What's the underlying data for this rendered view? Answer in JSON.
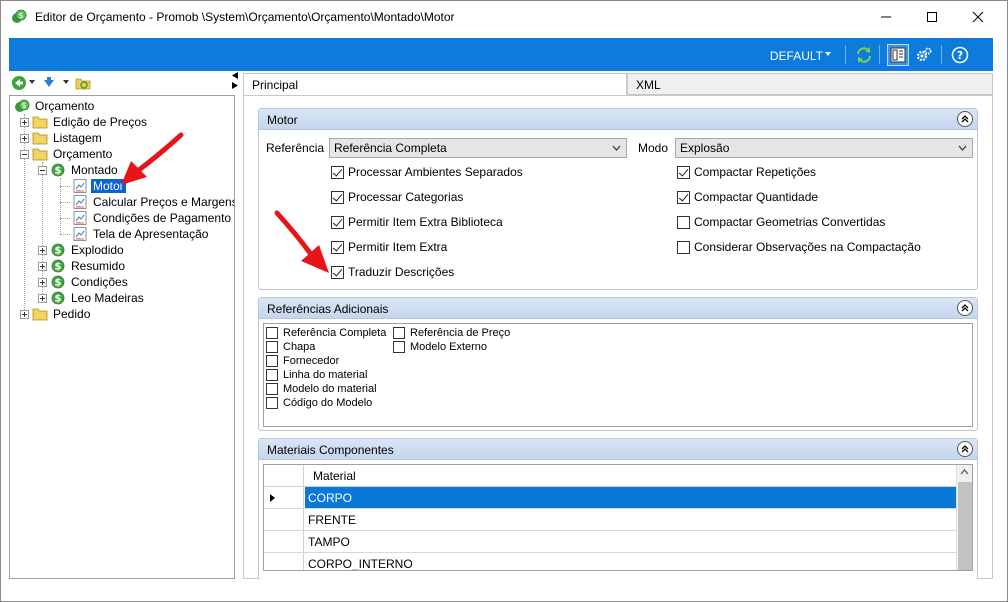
{
  "window": {
    "title": "Editor de Orçamento - Promob \\System\\Orçamento\\Orçamento\\Montado\\Motor"
  },
  "toolbar": {
    "profile_label": "DEFAULT",
    "icons": [
      "refresh-icon",
      "layout-icon",
      "settings-gears-icon",
      "help-icon"
    ]
  },
  "tree": {
    "root": "Orçamento",
    "nodes": [
      {
        "label": "Edição de Preços",
        "level": 1,
        "icon": "folder",
        "expander": "plus"
      },
      {
        "label": "Listagem",
        "level": 1,
        "icon": "folder",
        "expander": "plus"
      },
      {
        "label": "Orçamento",
        "level": 1,
        "icon": "folder",
        "expander": "minus"
      },
      {
        "label": "Montado",
        "level": 2,
        "icon": "money",
        "expander": "minus"
      },
      {
        "label": "Motor",
        "level": 3,
        "icon": "doc",
        "selected": true
      },
      {
        "label": "Calcular Preços e Margens",
        "level": 3,
        "icon": "doc"
      },
      {
        "label": "Condições de Pagamento",
        "level": 3,
        "icon": "doc"
      },
      {
        "label": "Tela de Apresentação",
        "level": 3,
        "icon": "doc"
      },
      {
        "label": "Explodido",
        "level": 2,
        "icon": "money",
        "expander": "plus"
      },
      {
        "label": "Resumido",
        "level": 2,
        "icon": "money",
        "expander": "plus"
      },
      {
        "label": "Condições",
        "level": 2,
        "icon": "money",
        "expander": "plus"
      },
      {
        "label": "Leo Madeiras",
        "level": 2,
        "icon": "money",
        "expander": "plus"
      },
      {
        "label": "Pedido",
        "level": 1,
        "icon": "folder",
        "expander": "plus"
      }
    ]
  },
  "tabs": [
    {
      "label": "Principal",
      "active": true
    },
    {
      "label": "XML",
      "active": false
    }
  ],
  "motor": {
    "header": "Motor",
    "referencia_label": "Referência",
    "referencia_value": "Referência Completa",
    "modo_label": "Modo",
    "modo_value": "Explosão",
    "left_checks": [
      {
        "label": "Processar Ambientes Separados",
        "checked": true
      },
      {
        "label": "Processar Categorias",
        "checked": true
      },
      {
        "label": "Permitir Item Extra Biblioteca",
        "checked": true
      },
      {
        "label": "Permitir Item Extra",
        "checked": true
      },
      {
        "label": "Traduzir Descrições",
        "checked": true
      }
    ],
    "right_checks": [
      {
        "label": "Compactar Repetições",
        "checked": true
      },
      {
        "label": "Compactar Quantidade",
        "checked": true
      },
      {
        "label": "Compactar Geometrias Convertidas",
        "checked": false
      },
      {
        "label": "Considerar Observações na Compactação",
        "checked": false
      }
    ]
  },
  "refs": {
    "header": "Referências Adicionais",
    "col1": [
      "Referência Completa",
      "Chapa",
      "Fornecedor",
      "Linha do material",
      "Modelo do material",
      "Código do Modelo"
    ],
    "col2": [
      "Referência de Preço",
      "Modelo Externo"
    ]
  },
  "materiais": {
    "header": "Materiais Componentes",
    "column": "Material",
    "rows": [
      "CORPO",
      "FRENTE",
      "TAMPO",
      "CORPO_INTERNO"
    ],
    "selected_row": 0
  },
  "colors": {
    "accent": "#0c7bdc",
    "selection": "#0a78d7",
    "annotation": "#e8141b"
  }
}
